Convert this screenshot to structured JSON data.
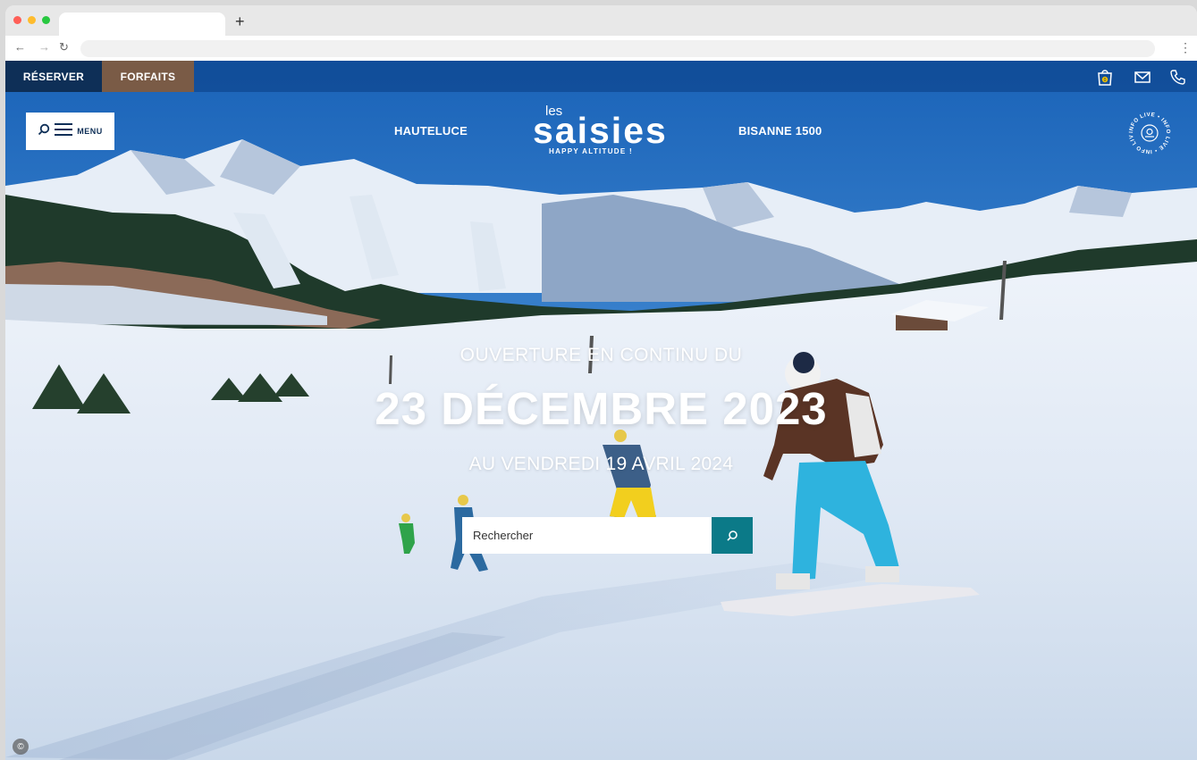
{
  "browser": {
    "new_tab_label": "+",
    "back_icon": "arrow-left-icon",
    "forward_icon": "arrow-right-icon",
    "reload_icon": "reload-icon",
    "menu_icon": "kebab-menu-icon",
    "traffic_light_colors": [
      "#ff5f57",
      "#febc2e",
      "#28c840"
    ]
  },
  "topbar": {
    "reserver_label": "RÉSERVER",
    "forfaits_label": "FORFAITS",
    "icons": [
      "shopping-bag-icon",
      "mail-icon",
      "phone-icon"
    ],
    "cart_count": "0"
  },
  "header": {
    "menu_label": "MENU",
    "nav_left": "HAUTELUCE",
    "nav_right": "BISANNE 1500",
    "logo": {
      "prefix": "les",
      "name": "saisies",
      "tagline": "HAPPY ALTITUDE !"
    },
    "info_live_text": "INFO LIVE • INFO LIVE • INFO LIVE •"
  },
  "hero": {
    "line1": "OUVERTURE EN CONTINU DU",
    "line2": "23 DÉCEMBRE 2023",
    "line3": "AU VENDREDI 19 AVRIL 2024"
  },
  "search": {
    "placeholder": "Rechercher"
  },
  "footer": {
    "copyright_symbol": "©"
  },
  "colors": {
    "reserver_bg": "#0e2f57",
    "forfaits_bg": "#7a5b46",
    "search_button_bg": "#0b7a88"
  }
}
